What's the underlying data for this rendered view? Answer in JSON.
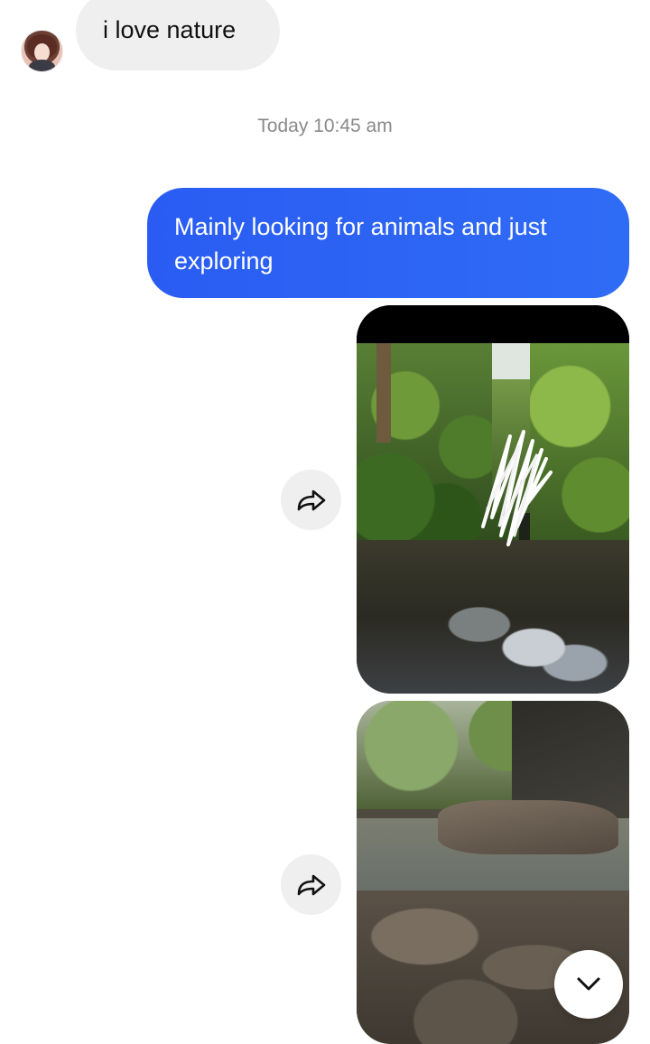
{
  "thread": {
    "incoming_message": "i love nature",
    "timestamp": "Today 10:45 am",
    "outgoing_message": "Mainly looking for animals and just exploring"
  },
  "attachments": [
    {
      "type": "photo",
      "subject": "forest stream with dense foliage"
    },
    {
      "type": "photo",
      "subject": "rocky stream bed"
    }
  ],
  "icons": {
    "share": "share-arrow-icon",
    "scroll_down": "chevron-down-icon",
    "avatar": "avatar"
  },
  "colors": {
    "outgoing_bubble": "#2f6cf5",
    "incoming_bubble": "#efefef",
    "timestamp_text": "#8a8a8a"
  }
}
